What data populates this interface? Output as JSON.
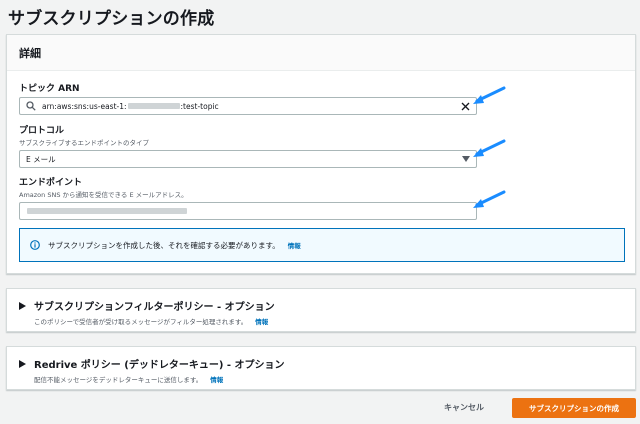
{
  "page": {
    "title": "サブスクリプションの作成"
  },
  "details": {
    "header": "詳細",
    "topic_arn": {
      "label": "トピック ARN",
      "value_prefix": "arn:aws:sns:us-east-1:",
      "value_suffix": ":test-topic"
    },
    "protocol": {
      "label": "プロトコル",
      "description": "サブスクライブするエンドポイントのタイプ",
      "selected": "E メール"
    },
    "endpoint": {
      "label": "エンドポイント",
      "description": "Amazon SNS から通知を受信できる E メールアドレス。"
    },
    "info": {
      "text": "サブスクリプションを作成した後、それを確認する必要があります。",
      "link": "情報"
    }
  },
  "filter_policy": {
    "title": "サブスクリプションフィルターポリシー - オプション",
    "description": "このポリシーで受信者が受け取るメッセージがフィルター処理されます。",
    "link": "情報"
  },
  "redrive_policy": {
    "title": "Redrive ポリシー (デッドレターキュー) - オプション",
    "description": "配信不能メッセージをデッドレターキューに送信します。",
    "link": "情報"
  },
  "footer": {
    "cancel_label": "キャンセル",
    "create_label": "サブスクリプションの作成"
  },
  "colors": {
    "primary_button": "#ec7211",
    "link": "#0073bb",
    "annotation_arrow": "#1a8cff"
  }
}
